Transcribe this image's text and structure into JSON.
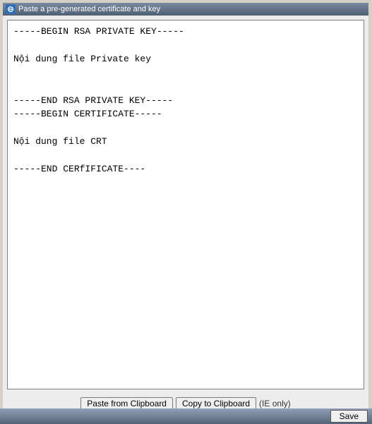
{
  "panel": {
    "title": "Paste a pre-generated certificate and key"
  },
  "textarea": {
    "value": "-----BEGIN RSA PRIVATE KEY-----\n\nNội dung file Private key\n\n\n-----END RSA PRIVATE KEY-----\n-----BEGIN CERTIFICATE-----\n\nNội dung file CRT\n\n-----END CERfIFICATE----"
  },
  "clipboard": {
    "paste_label": "Paste from Clipboard",
    "copy_label": "Copy to Clipboard",
    "note": "(IE only)"
  },
  "footer": {
    "save_label": "Save"
  }
}
